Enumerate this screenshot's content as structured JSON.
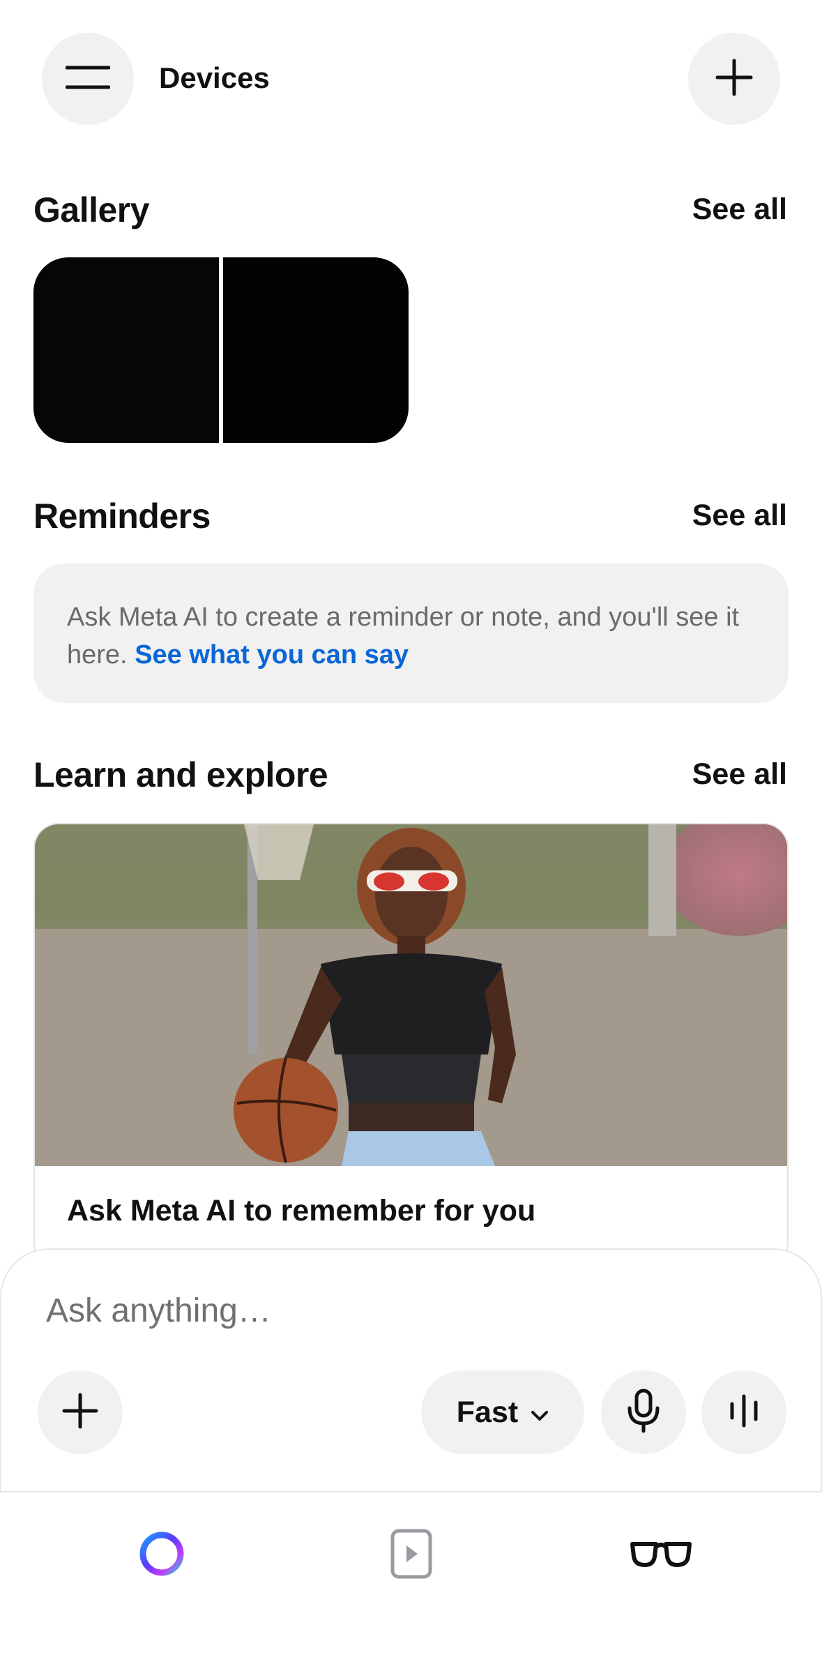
{
  "header": {
    "title": "Devices",
    "menu_icon": "hamburger-menu-icon",
    "add_icon": "plus-icon"
  },
  "gallery": {
    "title": "Gallery",
    "see_all": "See all",
    "thumbnails": 2
  },
  "reminders": {
    "title": "Reminders",
    "see_all": "See all",
    "empty_text": "Ask Meta AI to create a reminder or note, and you'll see it here.",
    "link_text": "See what you can say"
  },
  "learn": {
    "title": "Learn and explore",
    "see_all": "See all",
    "card_title": "Ask Meta AI to remember for you"
  },
  "composer": {
    "placeholder": "Ask anything…",
    "mode_label": "Fast",
    "icons": [
      "plus-icon",
      "chevron-down-icon",
      "microphone-icon",
      "voice-waveform-icon"
    ]
  },
  "tabbar": {
    "tabs": [
      "meta-ai-icon",
      "media-play-icon",
      "glasses-icon"
    ],
    "active_tab": "glasses-icon"
  },
  "colors": {
    "link": "#0a66d6",
    "card_bg": "#f1f1f2",
    "text": "#111111"
  }
}
